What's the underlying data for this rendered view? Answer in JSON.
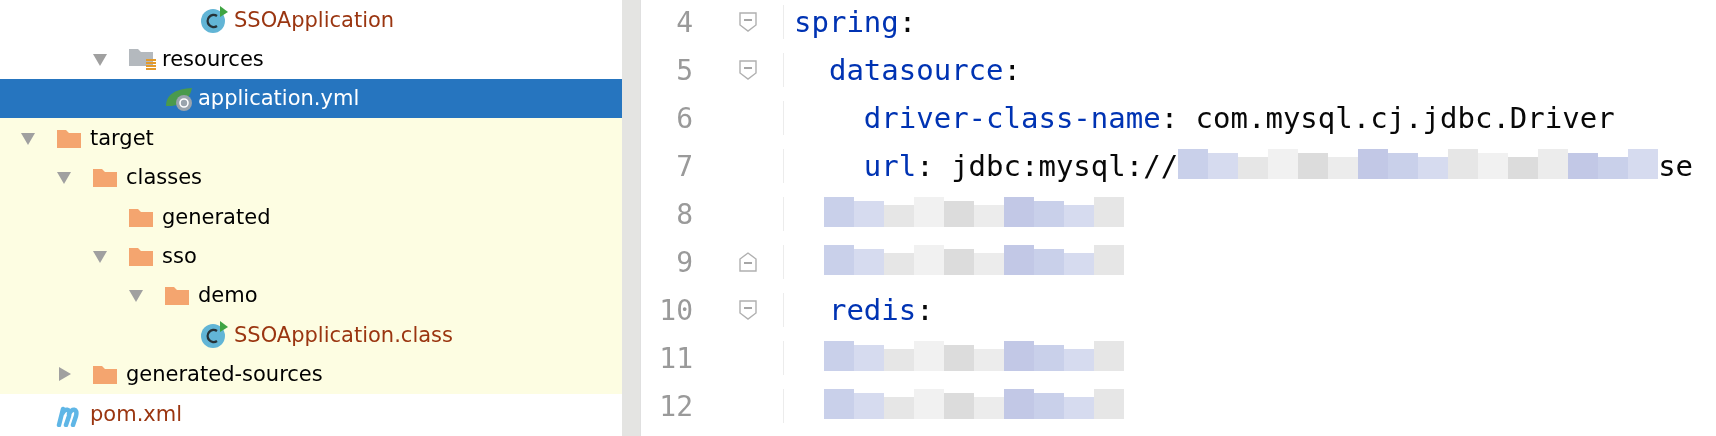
{
  "project_tree": {
    "items": [
      {
        "children": [
          {
            "children": [
              {
                "children": [
                  {
                    "children": [
                      {
                        "label": "SSOApplication",
                        "kind": "class",
                        "color": "#9a3510",
                        "selected": false,
                        "highlighted": false
                      }
                    ]
                  }
                ]
              },
              {
                "label": "resources",
                "kind": "resources",
                "expanded": true,
                "color": "#000000",
                "selected": false,
                "highlighted": false,
                "children": [
                  {
                    "label": "application.yml",
                    "kind": "yml",
                    "color": "#ffffff",
                    "selected": true,
                    "highlighted": false
                  }
                ]
              }
            ]
          }
        ]
      },
      {
        "label": "target",
        "kind": "folder",
        "expanded": true,
        "color": "#000000",
        "selected": false,
        "highlighted": true,
        "children": [
          {
            "label": "classes",
            "kind": "folder",
            "expanded": true,
            "color": "#000000",
            "selected": false,
            "highlighted": true,
            "children": [
              {
                "label": "generated",
                "kind": "folder",
                "color": "#000000",
                "selected": false,
                "highlighted": true
              },
              {
                "label": "sso",
                "kind": "folder",
                "expanded": true,
                "color": "#000000",
                "selected": false,
                "highlighted": true,
                "children": [
                  {
                    "label": "demo",
                    "kind": "folder",
                    "expanded": true,
                    "color": "#000000",
                    "selected": false,
                    "highlighted": true,
                    "children": [
                      {
                        "label": "SSOApplication.class",
                        "kind": "class",
                        "color": "#9a3510",
                        "selected": false,
                        "highlighted": true
                      }
                    ]
                  }
                ]
              }
            ]
          },
          {
            "label": "generated-sources",
            "kind": "folder",
            "expanded": false,
            "color": "#000000",
            "selected": false,
            "highlighted": true
          }
        ]
      },
      {
        "label": "pom.xml",
        "kind": "pom",
        "color": "#9a3510",
        "selected": false,
        "highlighted": false
      }
    ]
  },
  "editor": {
    "lines": [
      {
        "number": "4",
        "fold_start": true,
        "fold_end": false,
        "key": "spring",
        "sep": ":"
      },
      {
        "number": "5",
        "fold_start": true,
        "fold_end": false,
        "key": "  datasource",
        "sep": ":"
      },
      {
        "number": "6",
        "fold_start": false,
        "fold_end": false,
        "key": "    driver-class-name",
        "sep": ": ",
        "value": "com.mysql.cj.jdbc.Driver"
      },
      {
        "number": "7",
        "fold_start": false,
        "fold_end": false,
        "key": "    url",
        "sep": ": ",
        "value": "jdbc:mysql://",
        "redacted": true,
        "tail": "se"
      },
      {
        "number": "8",
        "fold_start": false,
        "fold_end": false,
        "redacted": true
      },
      {
        "number": "9",
        "fold_start": false,
        "fold_end": true,
        "redacted": true
      },
      {
        "number": "10",
        "fold_start": true,
        "fold_end": false,
        "key": "  redis",
        "sep": ":"
      },
      {
        "number": "11",
        "fold_start": false,
        "fold_end": false,
        "redacted": true
      },
      {
        "number": "12",
        "fold_start": false,
        "fold_end": false,
        "redacted": true
      }
    ]
  }
}
